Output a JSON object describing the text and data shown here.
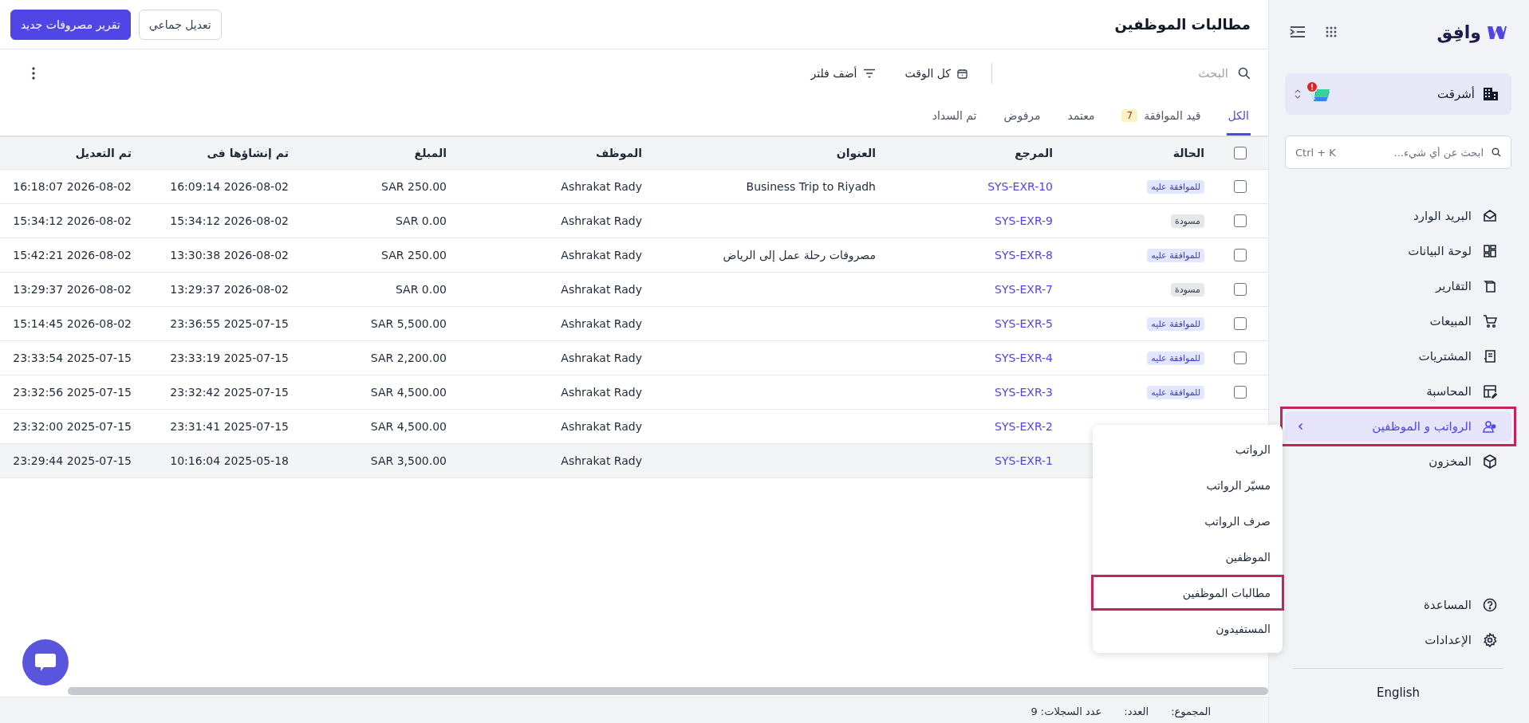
{
  "sidebar": {
    "logo": "وافِق",
    "company": "أشرقت",
    "company_alert": true,
    "search": {
      "placeholder": "ابحث عن أي شيء...",
      "shortcut": "Ctrl + K"
    },
    "items": [
      {
        "label": "البريد الوارد",
        "selected": false,
        "highlighted": false,
        "has_submenu": false
      },
      {
        "label": "لوحة البيانات",
        "selected": false,
        "highlighted": false,
        "has_submenu": false
      },
      {
        "label": "التقارير",
        "selected": false,
        "highlighted": false,
        "has_submenu": false
      },
      {
        "label": "المبيعات",
        "selected": false,
        "highlighted": false,
        "has_submenu": false
      },
      {
        "label": "المشتريات",
        "selected": false,
        "highlighted": false,
        "has_submenu": false
      },
      {
        "label": "المحاسبة",
        "selected": false,
        "highlighted": false,
        "has_submenu": false
      },
      {
        "label": "الرواتب و الموظفين",
        "selected": true,
        "highlighted": true,
        "has_submenu": true
      },
      {
        "label": "المخزون",
        "selected": false,
        "highlighted": false,
        "has_submenu": false
      }
    ],
    "bottom_items": [
      {
        "label": "المساعدة"
      },
      {
        "label": "الإعدادات"
      }
    ],
    "language": "English"
  },
  "page": {
    "title": "مطالبات الموظفين",
    "buttons": [
      {
        "label": "تعديل جماعي",
        "kind": "secondary"
      },
      {
        "label": "تقرير مصروفات جديد",
        "kind": "primary"
      }
    ]
  },
  "toolbar": {
    "search_placeholder": "البحث",
    "date_filter": "كل الوقت",
    "add_filter": "أضف فلتر"
  },
  "tabs": [
    {
      "label": "الكل",
      "selected": true
    },
    {
      "label": "قيد الموافقة",
      "count": "7",
      "selected": false
    },
    {
      "label": "معتمد",
      "selected": false
    },
    {
      "label": "مرفوض",
      "selected": false
    },
    {
      "label": "تم السداد",
      "selected": false
    }
  ],
  "table": {
    "select_all_checked": false,
    "columns": [
      "الحالة",
      "المرجع",
      "العنوان",
      "الموظف",
      "المبلغ",
      "تم إنشاؤها فى",
      "تم التعديل"
    ],
    "rows": [
      {
        "checked": false,
        "status": {
          "label": "للموافقة عليه",
          "kind": "pending"
        },
        "reference": "SYS-EXR-10",
        "title": "Business Trip to Riyadh",
        "employee": "Ashrakat Rady",
        "amount": "SAR 250.00",
        "created": "2026-08-02 16:09:14",
        "modified": "2026-08-02 16:18:07",
        "hovered": false
      },
      {
        "checked": false,
        "status": {
          "label": "مسودة",
          "kind": "draft"
        },
        "reference": "SYS-EXR-9",
        "employee": "Ashrakat Rady",
        "amount": "SAR 0.00",
        "created": "2026-08-02 15:34:12",
        "modified": "2026-08-02 15:34:12",
        "hovered": false
      },
      {
        "checked": false,
        "status": {
          "label": "للموافقة عليه",
          "kind": "pending"
        },
        "reference": "SYS-EXR-8",
        "title": "مصروفات رحلة عمل إلى الرياض",
        "employee": "Ashrakat Rady",
        "amount": "SAR 250.00",
        "created": "2026-08-02 13:30:38",
        "modified": "2026-08-02 15:42:21",
        "hovered": false
      },
      {
        "checked": false,
        "status": {
          "label": "مسودة",
          "kind": "draft"
        },
        "reference": "SYS-EXR-7",
        "employee": "Ashrakat Rady",
        "amount": "SAR 0.00",
        "created": "2026-08-02 13:29:37",
        "modified": "2026-08-02 13:29:37",
        "hovered": false
      },
      {
        "checked": false,
        "status": {
          "label": "للموافقة عليه",
          "kind": "pending"
        },
        "reference": "SYS-EXR-5",
        "employee": "Ashrakat Rady",
        "amount": "SAR 5,500.00",
        "created": "2025-07-15 23:36:55",
        "modified": "2026-08-02 15:14:45",
        "hovered": false
      },
      {
        "checked": false,
        "status": {
          "label": "للموافقة عليه",
          "kind": "pending"
        },
        "reference": "SYS-EXR-4",
        "employee": "Ashrakat Rady",
        "amount": "SAR 2,200.00",
        "created": "2025-07-15 23:33:19",
        "modified": "2025-07-15 23:33:54",
        "hovered": false
      },
      {
        "checked": false,
        "status": {
          "label": "للموافقة عليه",
          "kind": "pending"
        },
        "reference": "SYS-EXR-3",
        "employee": "Ashrakat Rady",
        "amount": "SAR 4,500.00",
        "created": "2025-07-15 23:32:42",
        "modified": "2025-07-15 23:32:56",
        "hovered": false
      },
      {
        "reference": "SYS-EXR-2",
        "employee": "Ashrakat Rady",
        "amount": "SAR 4,500.00",
        "created": "2025-07-15 23:31:41",
        "modified": "2025-07-15 23:32:00",
        "hovered": false
      },
      {
        "reference": "SYS-EXR-1",
        "employee": "Ashrakat Rady",
        "amount": "SAR 3,500.00",
        "created": "2025-05-18 10:16:04",
        "modified": "2025-07-15 23:29:44",
        "hovered": true
      }
    ]
  },
  "submenu": {
    "items": [
      {
        "label": "الرواتب",
        "highlighted": false
      },
      {
        "label": "مسيّر الرواتب",
        "highlighted": false
      },
      {
        "label": "صرف الرواتب",
        "highlighted": false
      },
      {
        "label": "الموظفين",
        "highlighted": false
      },
      {
        "label": "مطالبات الموظفين",
        "highlighted": true
      },
      {
        "label": "المستفيدون",
        "highlighted": false
      }
    ]
  },
  "footer": {
    "total_label": "المجموع:",
    "count_label": "العدد:",
    "records": "عدد السجلات: 9"
  }
}
